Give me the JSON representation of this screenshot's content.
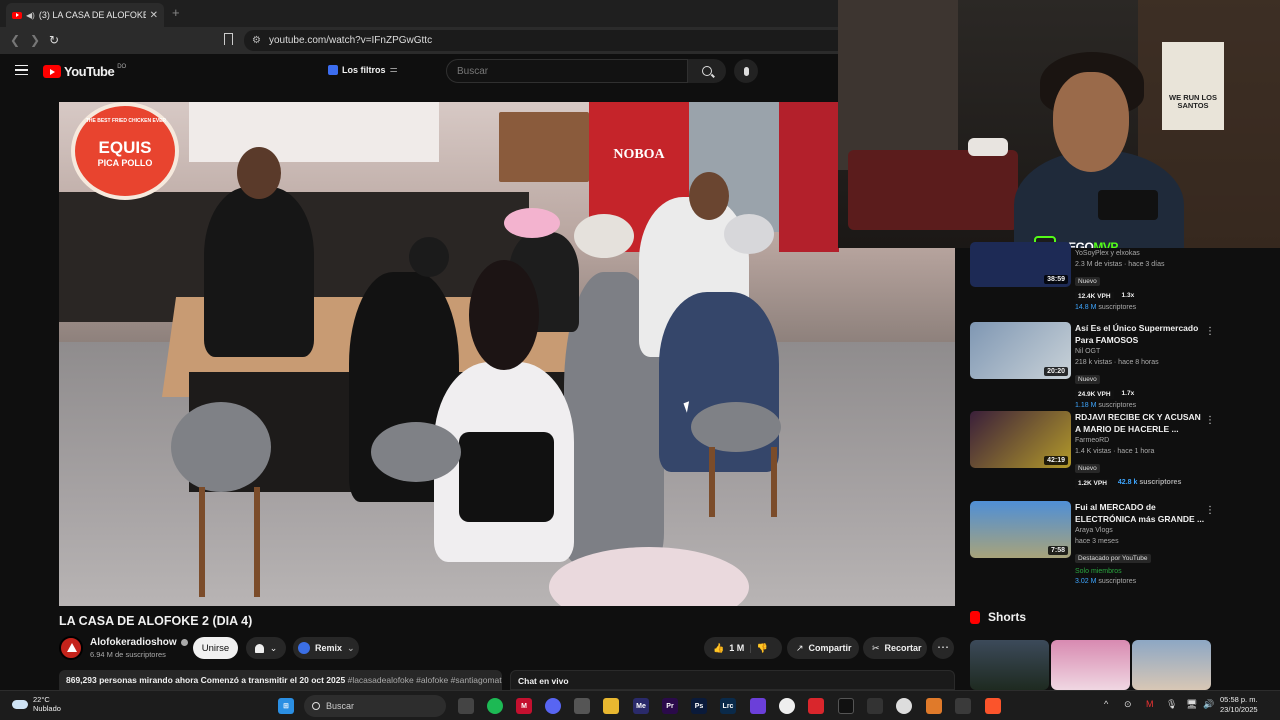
{
  "browser": {
    "tab_title": "(3) LA CASA DE ALOFOKE 2 (D",
    "tab_close": "✕",
    "new_tab": "+",
    "url": "youtube.com/watch?v=IFnZPGwGttc"
  },
  "youtube": {
    "logo_text": "YouTube",
    "logo_country": "DO",
    "filters_label": "Los filtros",
    "search_placeholder": "Buscar"
  },
  "video": {
    "sign_top": "THE BEST FRIED CHICKEN EVER",
    "sign_brand": "EQUIS",
    "sign_sub": "PICA POLLO",
    "fridge_brand": "NOBOA",
    "title": "LA CASA DE ALOFOKE 2 (DIA 4)"
  },
  "channel": {
    "name": "Alofokeradioshow",
    "subscribers": "6.94 M de suscriptores",
    "join_label": "Unirse",
    "remix_label": "Remix"
  },
  "actions": {
    "likes": "1 M",
    "share": "Compartir",
    "clip": "Recortar",
    "more": "⋯"
  },
  "description": {
    "viewers": "869,293 personas mirando ahora",
    "started": "Comenzó a transmitir el 20 oct 2025",
    "tags": "#lacasadealofoke #alofoke #santiagomat"
  },
  "chat": {
    "label": "Chat en vivo"
  },
  "webcam": {
    "poster_text": "WE RUN LOS SANTOS",
    "badge_letter": "K",
    "badge_name_a": "NEGO",
    "badge_name_b": "MVP"
  },
  "recommendations": [
    {
      "title": "",
      "channel": "YoSoyPlex y elxokas",
      "meta": "2.3 M de vistas · hace 3 días",
      "badge": "Nuevo",
      "vph": "12.4K VPH",
      "ratio": "1.3x",
      "subs_value": "14.8 M",
      "subs_suffix": "suscriptores",
      "duration": "38:59",
      "thumb_color": "#1d2a55"
    },
    {
      "title": "Así Es el Único Supermercado Para FAMOSOS",
      "channel": "Nil OGT",
      "meta": "218 k vistas · hace 8 horas",
      "badge": "Nuevo",
      "vph": "24.9K VPH",
      "ratio": "1.7x",
      "subs_value": "1.18 M",
      "subs_suffix": "suscriptores",
      "duration": "20:20",
      "thumb_color": "#6f8aa6"
    },
    {
      "title": "RDJAVI RECIBE CK Y ACUSAN A MARIO DE HACERLE ...",
      "channel": "FarmeoRD",
      "meta": "1.4 K vistas · hace 1 hora",
      "badge": "Nuevo",
      "vph": "1.2K VPH",
      "subs_value": "42.8 k",
      "subs_suffix": "suscriptores",
      "duration": "42:19",
      "thumb_color": "#3a2a4a"
    },
    {
      "title": "Fui al MERCADO de ELECTRÓNICA más GRANDE ...",
      "channel": "Araya Vlogs",
      "meta": "hace 3 meses",
      "featured": "Destacado por YouTube",
      "members": "Solo miembros",
      "subs_value": "3.02 M",
      "subs_suffix": "suscriptores",
      "duration": "7:58",
      "thumb_color": "#3a7ac2"
    }
  ],
  "shorts": {
    "label": "Shorts"
  },
  "taskbar": {
    "temp": "22°C",
    "condition": "Nublado",
    "search": "Buscar",
    "time": "05:58 p. m.",
    "date": "23/10/2025"
  },
  "colors": {
    "accent_red": "#ff0000",
    "kick_green": "#53fc18",
    "link_blue": "#3ea6ff"
  }
}
